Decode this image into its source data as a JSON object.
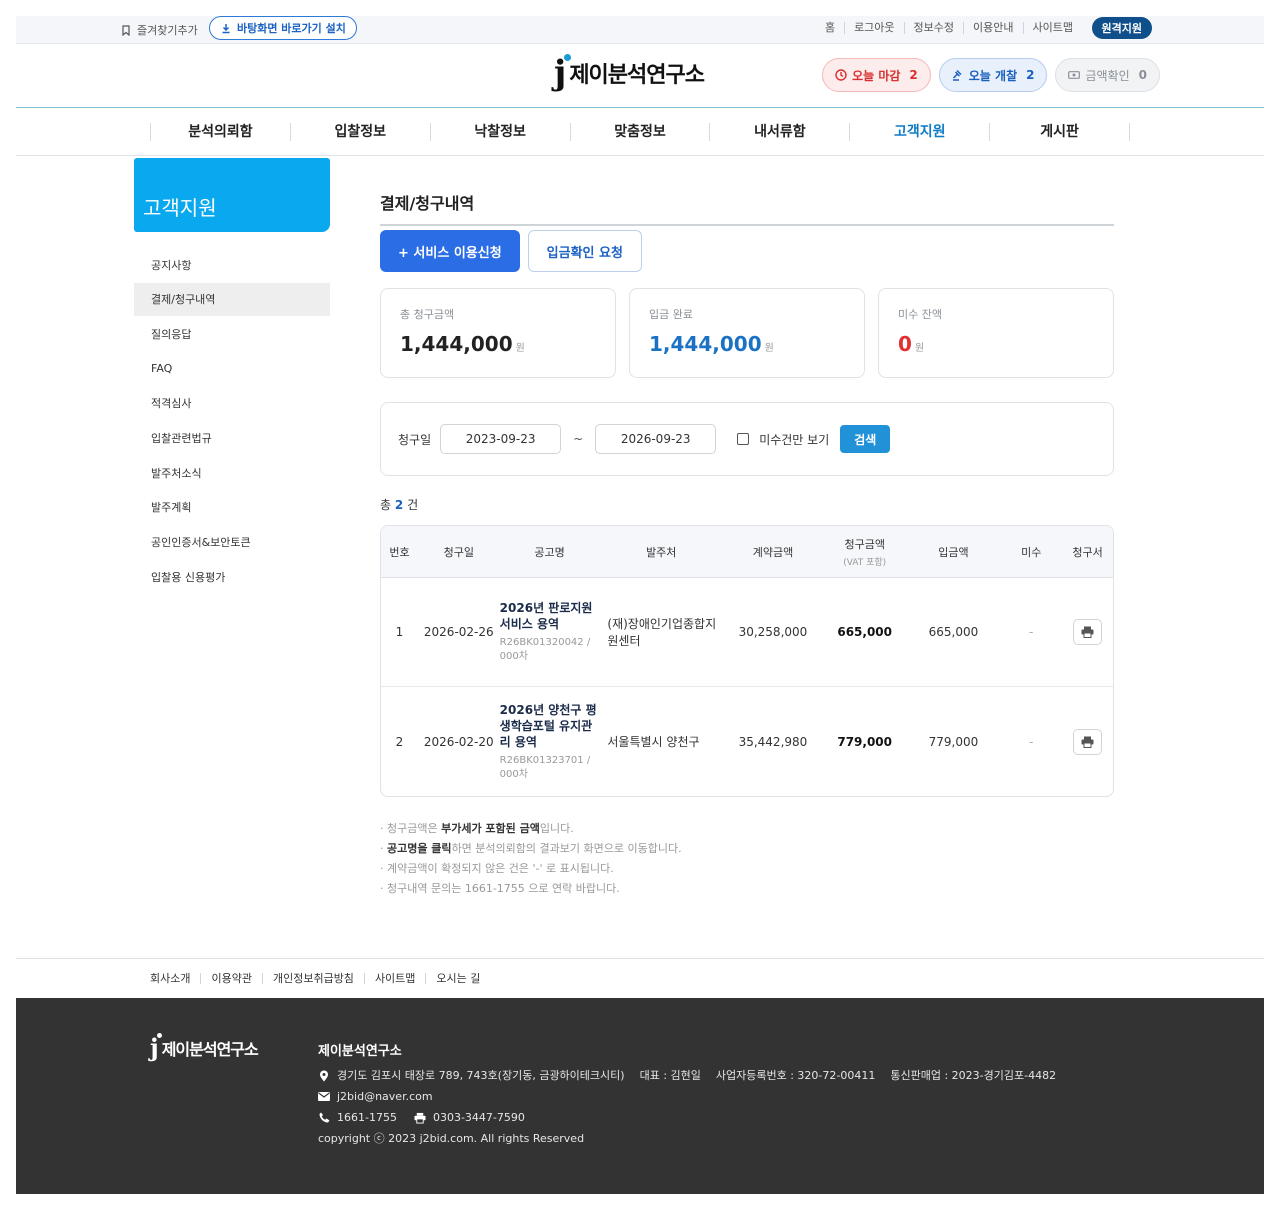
{
  "topbar": {
    "bookmark": "즐겨찾기추가",
    "install": "바탕화면 바로가기 설치",
    "links": [
      "홈",
      "로그아웃",
      "정보수정",
      "이용안내",
      "사이트맵"
    ],
    "remote": "원격지원"
  },
  "header": {
    "logo_mark": "j",
    "logo_text": "제이분석연구소",
    "buttons": [
      {
        "label": "오늘 마감",
        "count": "2"
      },
      {
        "label": "오늘 개찰",
        "count": "2"
      },
      {
        "label": "금액확인",
        "count": "0"
      }
    ]
  },
  "nav": [
    "분석의뢰함",
    "입찰정보",
    "낙찰정보",
    "맞춤정보",
    "내서류함",
    "고객지원",
    "게시판"
  ],
  "sidebar": {
    "title": "고객지원",
    "items": [
      "공지사항",
      "결제/청구내역",
      "질의응답",
      "FAQ",
      "적격심사",
      "입찰관련법규",
      "발주처소식",
      "발주계획",
      "공인인증서&보안토큰",
      "입찰용 신용평가"
    ]
  },
  "main": {
    "title": "결제/청구내역",
    "btn_apply": "+ 서비스 이용신청",
    "btn_deposit": "입금확인 요청",
    "cards": [
      {
        "label": "총 청구금액",
        "value": "1,444,000",
        "unit": "원"
      },
      {
        "label": "입금 완료",
        "value": "1,444,000",
        "unit": "원"
      },
      {
        "label": "미수 잔액",
        "value": "0",
        "unit": "원"
      }
    ],
    "filter": {
      "label": "청구일",
      "from": "2023-09-23",
      "tilde": "~",
      "to": "2026-09-23",
      "unpaid_only": "미수건만 보기",
      "search": "검색"
    },
    "total": {
      "prefix": "총",
      "count": "2",
      "suffix": "건"
    },
    "table": {
      "headers": [
        "번호",
        "청구일",
        "공고명",
        "발주처",
        "계약금액",
        "청구금액",
        "입금액",
        "미수",
        "청구서"
      ],
      "header_sub": "(VAT 포함)",
      "rows": [
        {
          "no": "1",
          "date": "2026-02-26",
          "title": "2026년 판로지원서비스 용역",
          "code": "R26BK01320042 / 000차",
          "agency": "(재)장애인기업종합지원센터",
          "contract": "30,258,000",
          "billed": "665,000",
          "paid": "665,000",
          "unpaid": "-"
        },
        {
          "no": "2",
          "date": "2026-02-20",
          "title": "2026년 양천구 평생학습포털 유지관리 용역",
          "code": "R26BK01323701 / 000차",
          "agency": "서울특별시 양천구",
          "contract": "35,442,980",
          "billed": "779,000",
          "paid": "779,000",
          "unpaid": "-"
        }
      ]
    },
    "notes": [
      {
        "pre": "· 청구금액은 ",
        "bold": "부가세가 포함된 금액",
        "post": "입니다."
      },
      {
        "pre": "· ",
        "bold": "공고명을 클릭",
        "post": "하면 분석의뢰함의 결과보기 화면으로 이동합니다."
      },
      {
        "pre": "· 계약금액이 확정되지 않은 건은 '-' 로 표시됩니다.",
        "bold": "",
        "post": ""
      },
      {
        "pre": "· 청구내역 문의는 1661-1755 으로 연락 바랍니다.",
        "bold": "",
        "post": ""
      }
    ]
  },
  "footer": {
    "links": [
      "회사소개",
      "이용약관",
      "개인정보취급방침",
      "사이트맵",
      "오시는 길"
    ],
    "logo_mark": "j",
    "logo_text": "제이분석연구소",
    "company": "제이분석연구소",
    "address": "경기도 김포시 태장로 789, 743호(장기동, 금광하이테크시티)",
    "ceo": "대표 : 김현일",
    "bizno": "사업자등록번호 : 320-72-00411",
    "mailorder": "통신판매업 : 2023-경기김포-4482",
    "email": "j2bid@naver.com",
    "phone": "1661-1755",
    "fax": "0303-3447-7590",
    "copyright": "copyright ⓒ 2023 j2bid.com. All rights Reserved"
  },
  "colors": {
    "accent": "#0aa8ee",
    "primary": "#2b6de5",
    "brand_dark": "#0f4f8a",
    "danger": "#e0302f",
    "footer": "#333333"
  }
}
